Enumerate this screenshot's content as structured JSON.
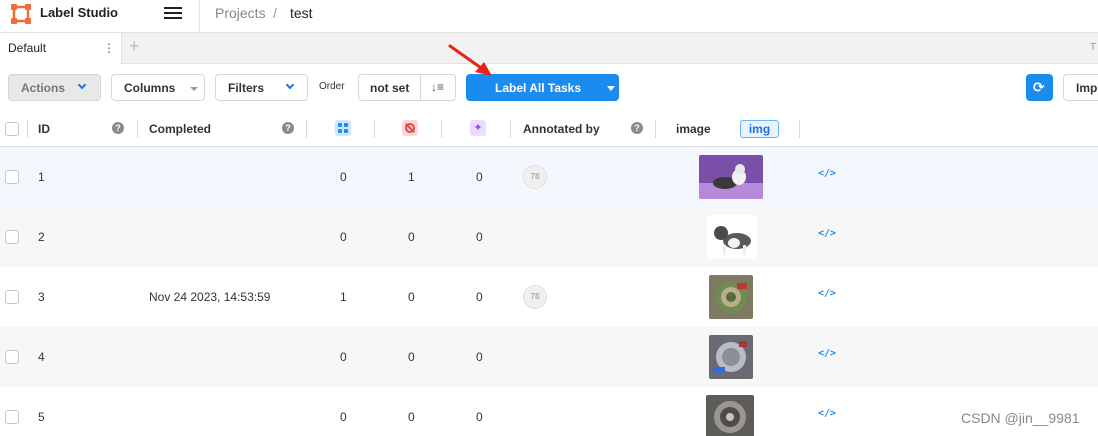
{
  "header": {
    "app_name": "Label Studio",
    "breadcrumb": [
      "Projects",
      "/",
      "test"
    ]
  },
  "tabs": {
    "items": [
      {
        "label": "Default",
        "menu_glyph": "⋮"
      }
    ],
    "add_glyph": "+",
    "right_partial": "T"
  },
  "toolbar": {
    "actions_label": "Actions",
    "columns_label": "Columns",
    "filters_label": "Filters",
    "order_label": "Order",
    "order_value": "not set",
    "label_all_label": "Label All Tasks",
    "import_label": "Impo"
  },
  "table": {
    "columns": {
      "id": "ID",
      "completed": "Completed",
      "annotated_by": "Annotated by",
      "image": "image",
      "image_badge": "img"
    },
    "help_glyph": "?",
    "pred_glyph": "✦",
    "rows": [
      {
        "id": "1",
        "completed": "",
        "total": "0",
        "cancelled": "1",
        "predictions": "0",
        "annotator": "78",
        "code": "</>"
      },
      {
        "id": "2",
        "completed": "",
        "total": "0",
        "cancelled": "0",
        "predictions": "0",
        "annotator": "",
        "code": "</>"
      },
      {
        "id": "3",
        "completed": "Nov 24 2023, 14:53:59",
        "total": "1",
        "cancelled": "0",
        "predictions": "0",
        "annotator": "78",
        "code": "</>"
      },
      {
        "id": "4",
        "completed": "",
        "total": "0",
        "cancelled": "0",
        "predictions": "0",
        "annotator": "",
        "code": "</>"
      },
      {
        "id": "5",
        "completed": "",
        "total": "0",
        "cancelled": "0",
        "predictions": "0",
        "annotator": "",
        "code": "</>"
      }
    ]
  },
  "watermark": "CSDN @jin__9981",
  "colors": {
    "accent": "#1a8cf0",
    "arrow": "#e8231a"
  }
}
